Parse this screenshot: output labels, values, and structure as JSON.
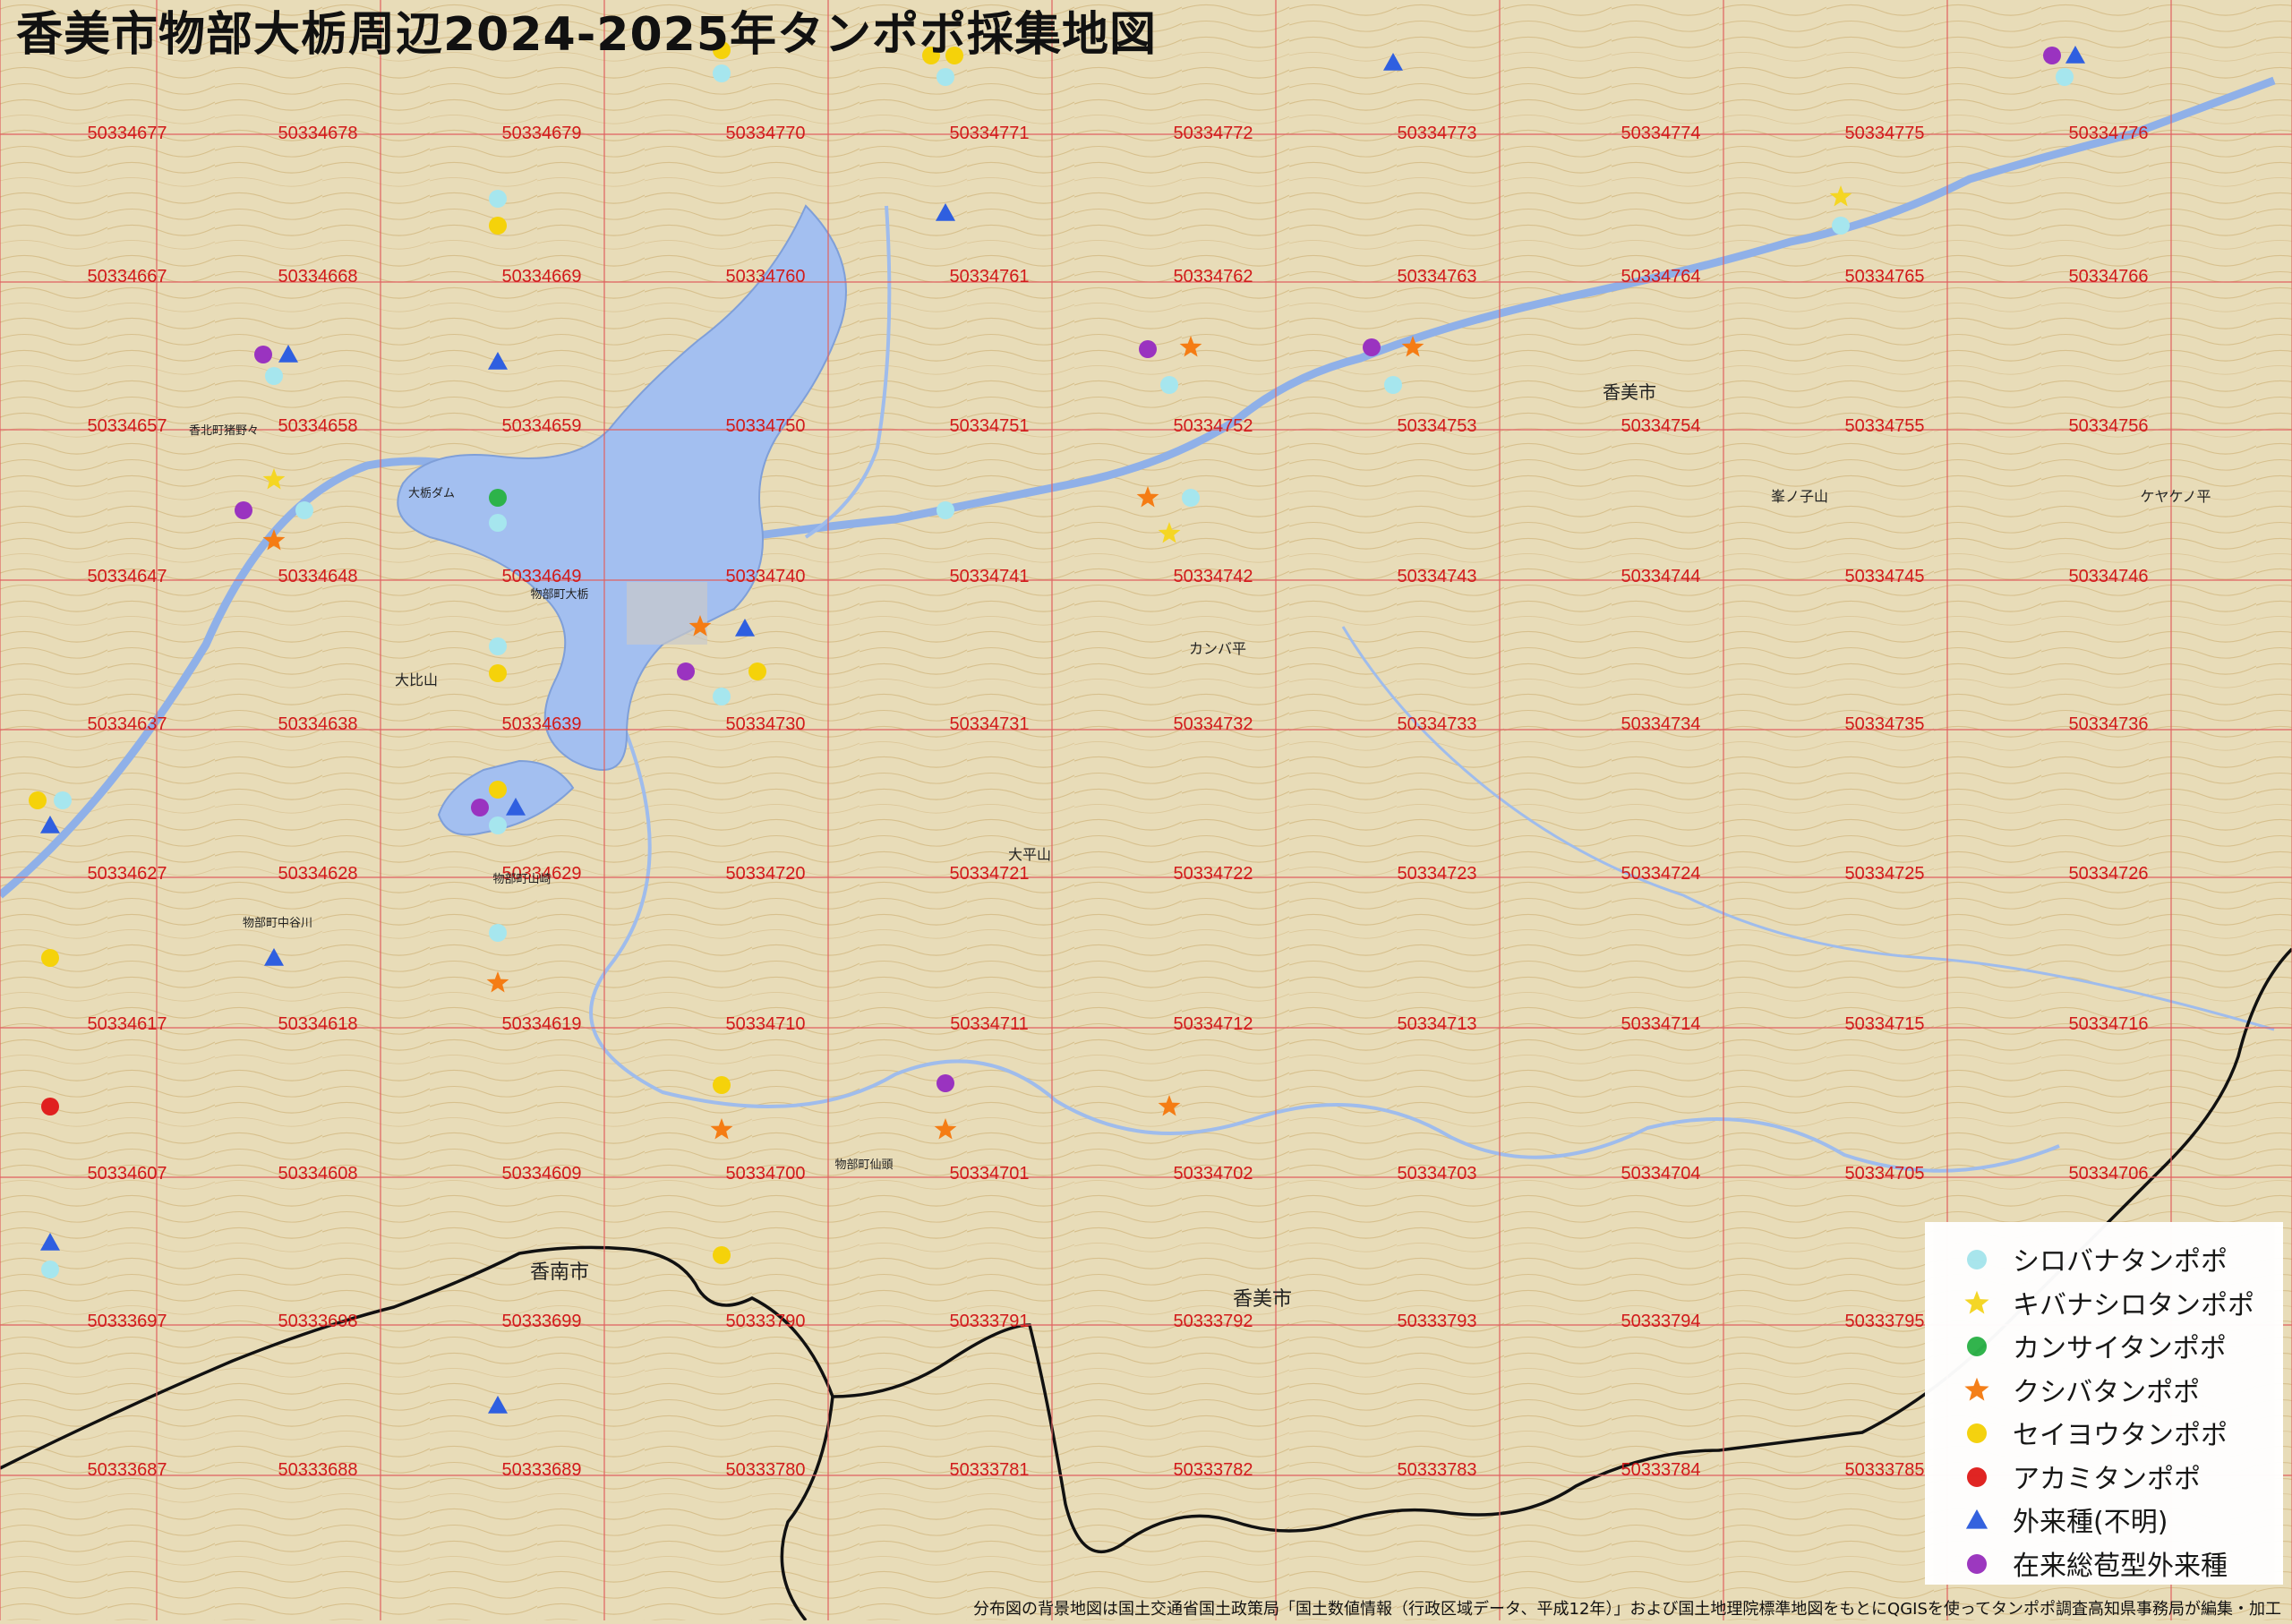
{
  "title": "香美市物部大栃周辺2024-2025年タンポポ採集地図",
  "credit": "分布図の背景地図は国土交通省国土政策局「国土数値情報（行政区域データ、平成12年）」および国土地理院標準地図をもとにQGISを使ってタンポポ調査高知県事務局が編集・加工",
  "colors": {
    "shirobana": "#a6e6ee",
    "kibanashiro": "#f5d623",
    "kansai": "#2db34a",
    "kushiba": "#f57c14",
    "seiyou": "#f5d20a",
    "akami": "#e0201f",
    "gairai": "#2f5fe0",
    "sougou": "#9a33c0",
    "grid": "#e06060",
    "water": "#a3bff0",
    "terrain": "#e8dcb8",
    "border": "#111111"
  },
  "legend": [
    {
      "key": "shirobana",
      "label": "シロバナタンポポ",
      "icon": "circle"
    },
    {
      "key": "kibanashiro",
      "label": "キバナシロタンポポ",
      "icon": "star"
    },
    {
      "key": "kansai",
      "label": "カンサイタンポポ",
      "icon": "circle"
    },
    {
      "key": "kushiba",
      "label": "クシバタンポポ",
      "icon": "star"
    },
    {
      "key": "seiyou",
      "label": "セイヨウタンポポ",
      "icon": "circle"
    },
    {
      "key": "akami",
      "label": "アカミタンポポ",
      "icon": "circle"
    },
    {
      "key": "gairai",
      "label": "外来種(不明)",
      "icon": "triangle"
    },
    {
      "key": "sougou",
      "label": "在来総苞型外来種",
      "icon": "circle"
    }
  ],
  "mesh_rows": [
    [
      "50334677",
      "50334678",
      "50334679",
      "50334770",
      "50334771",
      "50334772",
      "50334773",
      "50334774",
      "50334775",
      "50334776"
    ],
    [
      "50334667",
      "50334668",
      "50334669",
      "50334760",
      "50334761",
      "50334762",
      "50334763",
      "50334764",
      "50334765",
      "50334766"
    ],
    [
      "50334657",
      "50334658",
      "50334659",
      "50334750",
      "50334751",
      "50334752",
      "50334753",
      "50334754",
      "50334755",
      "50334756"
    ],
    [
      "50334647",
      "50334648",
      "50334649",
      "50334740",
      "50334741",
      "50334742",
      "50334743",
      "50334744",
      "50334745",
      "50334746"
    ],
    [
      "50334637",
      "50334638",
      "50334639",
      "50334730",
      "50334731",
      "50334732",
      "50334733",
      "50334734",
      "50334735",
      "50334736"
    ],
    [
      "50334627",
      "50334628",
      "50334629",
      "50334720",
      "50334721",
      "50334722",
      "50334723",
      "50334724",
      "50334725",
      "50334726"
    ],
    [
      "50334617",
      "50334618",
      "50334619",
      "50334710",
      "50334711",
      "50334712",
      "50334713",
      "50334714",
      "50334715",
      "50334716"
    ],
    [
      "50334607",
      "50334608",
      "50334609",
      "50334700",
      "50334701",
      "50334702",
      "50334703",
      "50334704",
      "50334705",
      "50334706"
    ],
    [
      "50333697",
      "50333698",
      "50333699",
      "50333790",
      "50333791",
      "50333792",
      "50333793",
      "50333794",
      "50333795",
      ""
    ],
    [
      "50333687",
      "50333688",
      "50333689",
      "50333780",
      "50333781",
      "50333782",
      "50333783",
      "50333784",
      "50333785",
      ""
    ]
  ],
  "places": [
    {
      "name": "香美市",
      "size": 20
    },
    {
      "name": "香美市",
      "size": 22
    },
    {
      "name": "香南市",
      "size": 22
    },
    {
      "name": "大比山",
      "size": 16
    },
    {
      "name": "大平山",
      "size": 16
    },
    {
      "name": "峯ノ子山",
      "size": 16
    },
    {
      "name": "ケヤケノ平",
      "size": 16
    },
    {
      "name": "カンバ平",
      "size": 16
    },
    {
      "name": "大栃ダム",
      "size": 13
    },
    {
      "name": "物部町大栃",
      "size": 13
    },
    {
      "name": "物部町山崎",
      "size": 13
    },
    {
      "name": "物部町仙頭",
      "size": 13
    },
    {
      "name": "物部町中谷川",
      "size": 13
    },
    {
      "name": "香北町猪野々",
      "size": 13
    }
  ]
}
